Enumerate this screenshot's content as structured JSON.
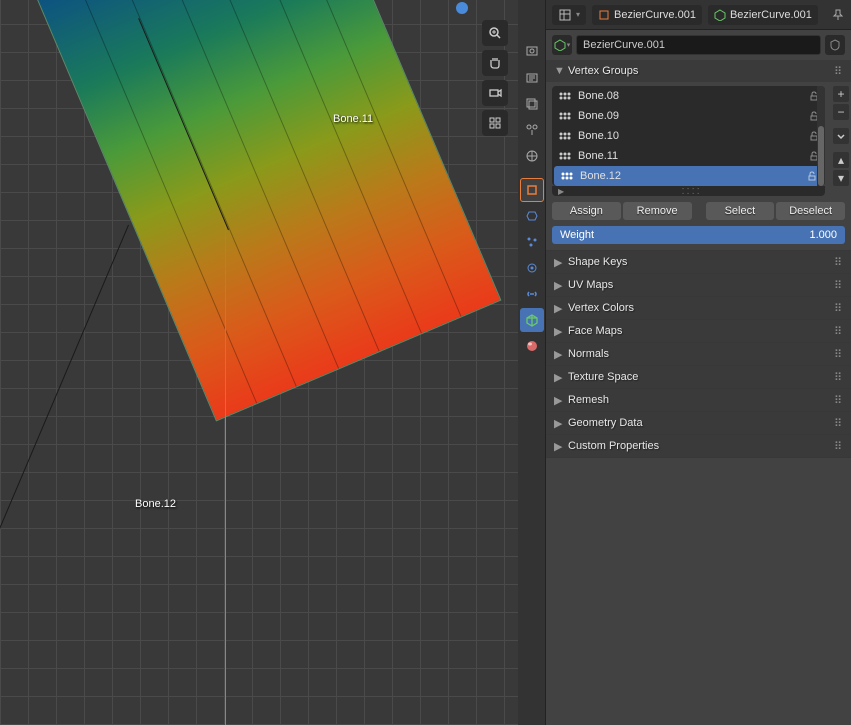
{
  "viewport": {
    "bone_label_1": "Bone.11",
    "bone_label_2": "Bone.12"
  },
  "header": {
    "obj1": "BezierCurve.001",
    "obj2": "BezierCurve.001"
  },
  "object_name": "BezierCurve.001",
  "sections": {
    "vertex_groups": "Vertex Groups",
    "shape_keys": "Shape Keys",
    "uv_maps": "UV Maps",
    "vertex_colors": "Vertex Colors",
    "face_maps": "Face Maps",
    "normals": "Normals",
    "texture_space": "Texture Space",
    "remesh": "Remesh",
    "geometry_data": "Geometry Data",
    "custom_properties": "Custom Properties"
  },
  "vertex_groups": [
    {
      "name": "Bone.08"
    },
    {
      "name": "Bone.09"
    },
    {
      "name": "Bone.10"
    },
    {
      "name": "Bone.11"
    },
    {
      "name": "Bone.12"
    }
  ],
  "buttons": {
    "assign": "Assign",
    "remove": "Remove",
    "select": "Select",
    "deselect": "Deselect"
  },
  "weight": {
    "label": "Weight",
    "value": "1.000"
  }
}
